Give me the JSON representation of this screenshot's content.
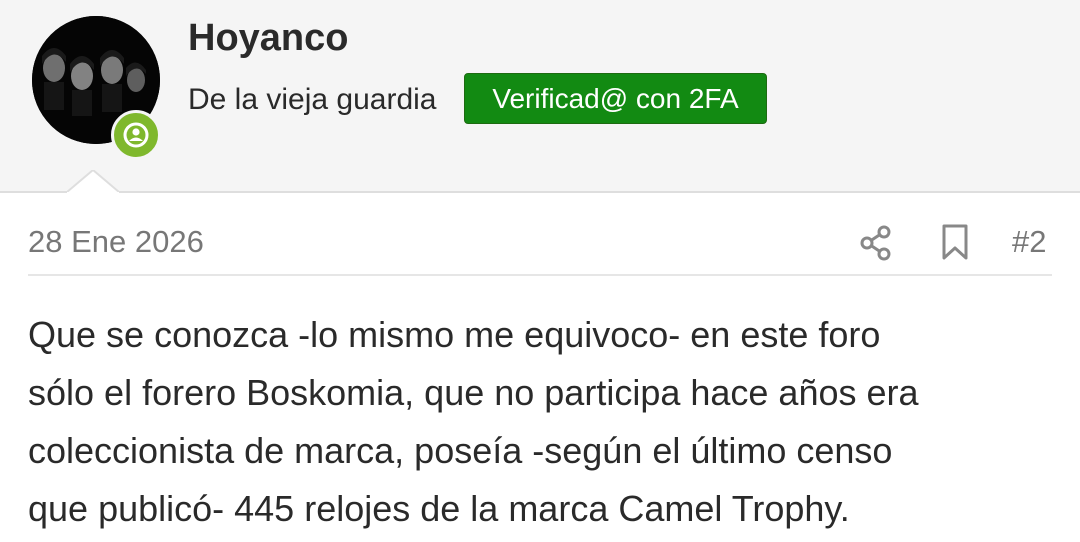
{
  "user": {
    "name": "Hoyanco",
    "title": "De la vieja guardia",
    "badge": "Verificad@ con 2FA",
    "status": "online",
    "avatar_icon": "band-photo-avatar",
    "status_icon": "user-icon"
  },
  "post": {
    "date": "28 Ene 2026",
    "number": "#2",
    "share_icon": "share-icon",
    "bookmark_icon": "bookmark-icon",
    "body_lines": [
      "Que se conozca -lo mismo me equivoco- en este foro",
      "sólo el forero Boskomia, que no participa hace años era",
      "coleccionista de marca, poseía -según el último censo",
      "que publicó- 445 relojes de la marca Camel Trophy."
    ]
  },
  "colors": {
    "header_bg": "#f5f5f5",
    "badge_green": "#128a12",
    "online_green": "#7fb82d",
    "muted_text": "#777777",
    "body_text": "#2a2a2a"
  }
}
